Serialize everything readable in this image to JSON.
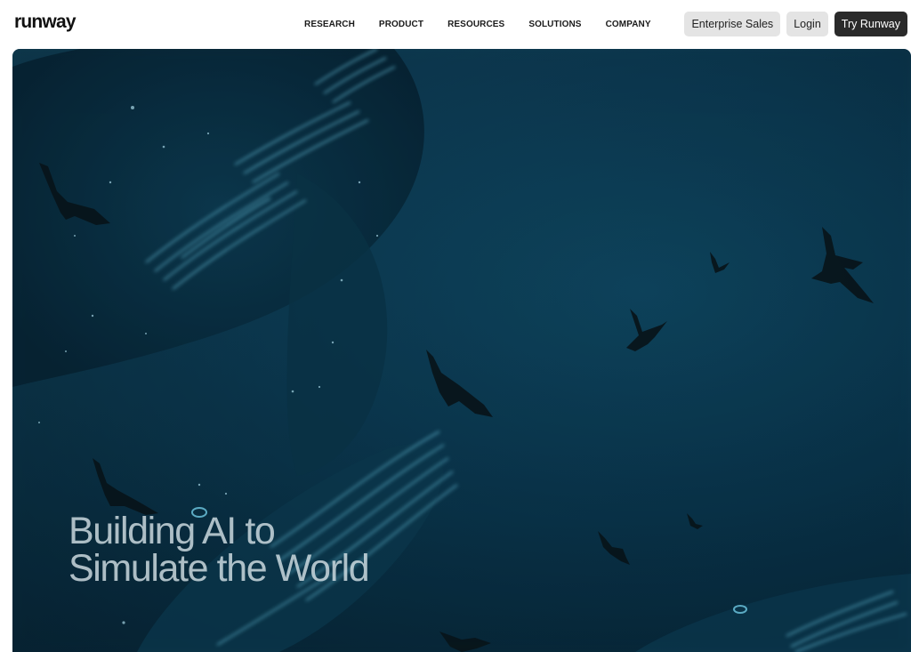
{
  "brand": {
    "logo_text": "runway"
  },
  "nav": {
    "items": [
      {
        "label": "RESEARCH"
      },
      {
        "label": "PRODUCT"
      },
      {
        "label": "RESOURCES"
      },
      {
        "label": "SOLUTIONS"
      },
      {
        "label": "COMPANY"
      }
    ]
  },
  "actions": {
    "enterprise_label": "Enterprise Sales",
    "login_label": "Login",
    "try_label": "Try Runway"
  },
  "hero": {
    "headline_line1": "Building AI to",
    "headline_line2": "Simulate the World",
    "colors": {
      "water_deep": "#072536",
      "water_light": "#0e4660",
      "glow": "#7fe4ff",
      "bird": "#0a1418"
    }
  }
}
